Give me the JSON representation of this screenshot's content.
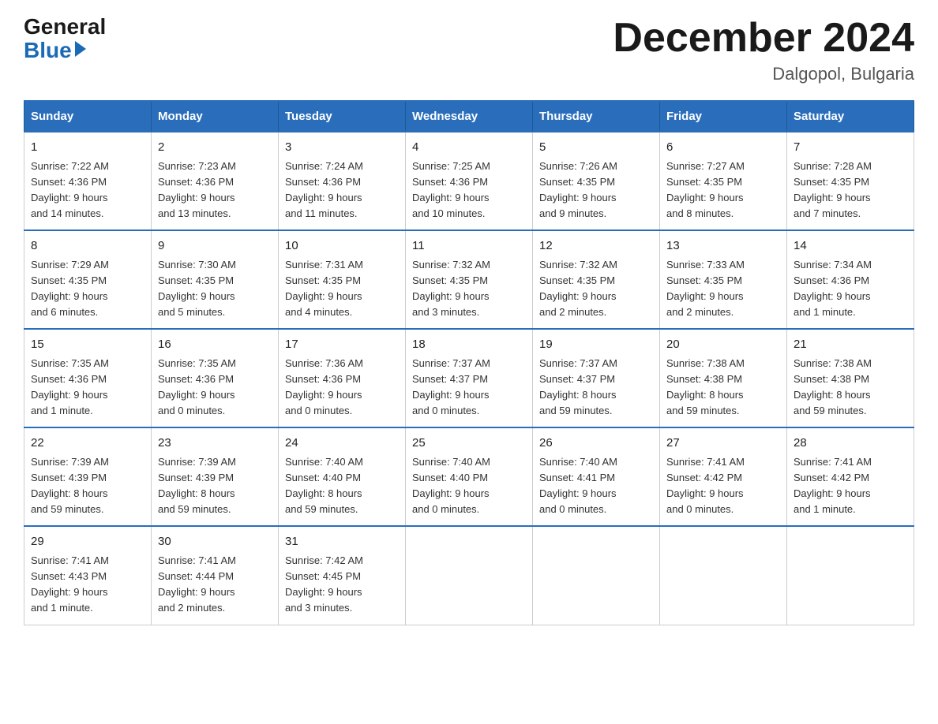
{
  "header": {
    "logo_general": "General",
    "logo_blue": "Blue",
    "month_title": "December 2024",
    "location": "Dalgopol, Bulgaria"
  },
  "weekdays": [
    "Sunday",
    "Monday",
    "Tuesday",
    "Wednesday",
    "Thursday",
    "Friday",
    "Saturday"
  ],
  "weeks": [
    [
      {
        "day": "1",
        "sunrise": "7:22 AM",
        "sunset": "4:36 PM",
        "daylight": "9 hours and 14 minutes."
      },
      {
        "day": "2",
        "sunrise": "7:23 AM",
        "sunset": "4:36 PM",
        "daylight": "9 hours and 13 minutes."
      },
      {
        "day": "3",
        "sunrise": "7:24 AM",
        "sunset": "4:36 PM",
        "daylight": "9 hours and 11 minutes."
      },
      {
        "day": "4",
        "sunrise": "7:25 AM",
        "sunset": "4:36 PM",
        "daylight": "9 hours and 10 minutes."
      },
      {
        "day": "5",
        "sunrise": "7:26 AM",
        "sunset": "4:35 PM",
        "daylight": "9 hours and 9 minutes."
      },
      {
        "day": "6",
        "sunrise": "7:27 AM",
        "sunset": "4:35 PM",
        "daylight": "9 hours and 8 minutes."
      },
      {
        "day": "7",
        "sunrise": "7:28 AM",
        "sunset": "4:35 PM",
        "daylight": "9 hours and 7 minutes."
      }
    ],
    [
      {
        "day": "8",
        "sunrise": "7:29 AM",
        "sunset": "4:35 PM",
        "daylight": "9 hours and 6 minutes."
      },
      {
        "day": "9",
        "sunrise": "7:30 AM",
        "sunset": "4:35 PM",
        "daylight": "9 hours and 5 minutes."
      },
      {
        "day": "10",
        "sunrise": "7:31 AM",
        "sunset": "4:35 PM",
        "daylight": "9 hours and 4 minutes."
      },
      {
        "day": "11",
        "sunrise": "7:32 AM",
        "sunset": "4:35 PM",
        "daylight": "9 hours and 3 minutes."
      },
      {
        "day": "12",
        "sunrise": "7:32 AM",
        "sunset": "4:35 PM",
        "daylight": "9 hours and 2 minutes."
      },
      {
        "day": "13",
        "sunrise": "7:33 AM",
        "sunset": "4:35 PM",
        "daylight": "9 hours and 2 minutes."
      },
      {
        "day": "14",
        "sunrise": "7:34 AM",
        "sunset": "4:36 PM",
        "daylight": "9 hours and 1 minute."
      }
    ],
    [
      {
        "day": "15",
        "sunrise": "7:35 AM",
        "sunset": "4:36 PM",
        "daylight": "9 hours and 1 minute."
      },
      {
        "day": "16",
        "sunrise": "7:35 AM",
        "sunset": "4:36 PM",
        "daylight": "9 hours and 0 minutes."
      },
      {
        "day": "17",
        "sunrise": "7:36 AM",
        "sunset": "4:36 PM",
        "daylight": "9 hours and 0 minutes."
      },
      {
        "day": "18",
        "sunrise": "7:37 AM",
        "sunset": "4:37 PM",
        "daylight": "9 hours and 0 minutes."
      },
      {
        "day": "19",
        "sunrise": "7:37 AM",
        "sunset": "4:37 PM",
        "daylight": "8 hours and 59 minutes."
      },
      {
        "day": "20",
        "sunrise": "7:38 AM",
        "sunset": "4:38 PM",
        "daylight": "8 hours and 59 minutes."
      },
      {
        "day": "21",
        "sunrise": "7:38 AM",
        "sunset": "4:38 PM",
        "daylight": "8 hours and 59 minutes."
      }
    ],
    [
      {
        "day": "22",
        "sunrise": "7:39 AM",
        "sunset": "4:39 PM",
        "daylight": "8 hours and 59 minutes."
      },
      {
        "day": "23",
        "sunrise": "7:39 AM",
        "sunset": "4:39 PM",
        "daylight": "8 hours and 59 minutes."
      },
      {
        "day": "24",
        "sunrise": "7:40 AM",
        "sunset": "4:40 PM",
        "daylight": "8 hours and 59 minutes."
      },
      {
        "day": "25",
        "sunrise": "7:40 AM",
        "sunset": "4:40 PM",
        "daylight": "9 hours and 0 minutes."
      },
      {
        "day": "26",
        "sunrise": "7:40 AM",
        "sunset": "4:41 PM",
        "daylight": "9 hours and 0 minutes."
      },
      {
        "day": "27",
        "sunrise": "7:41 AM",
        "sunset": "4:42 PM",
        "daylight": "9 hours and 0 minutes."
      },
      {
        "day": "28",
        "sunrise": "7:41 AM",
        "sunset": "4:42 PM",
        "daylight": "9 hours and 1 minute."
      }
    ],
    [
      {
        "day": "29",
        "sunrise": "7:41 AM",
        "sunset": "4:43 PM",
        "daylight": "9 hours and 1 minute."
      },
      {
        "day": "30",
        "sunrise": "7:41 AM",
        "sunset": "4:44 PM",
        "daylight": "9 hours and 2 minutes."
      },
      {
        "day": "31",
        "sunrise": "7:42 AM",
        "sunset": "4:45 PM",
        "daylight": "9 hours and 3 minutes."
      },
      null,
      null,
      null,
      null
    ]
  ],
  "labels": {
    "sunrise": "Sunrise:",
    "sunset": "Sunset:",
    "daylight": "Daylight:"
  }
}
